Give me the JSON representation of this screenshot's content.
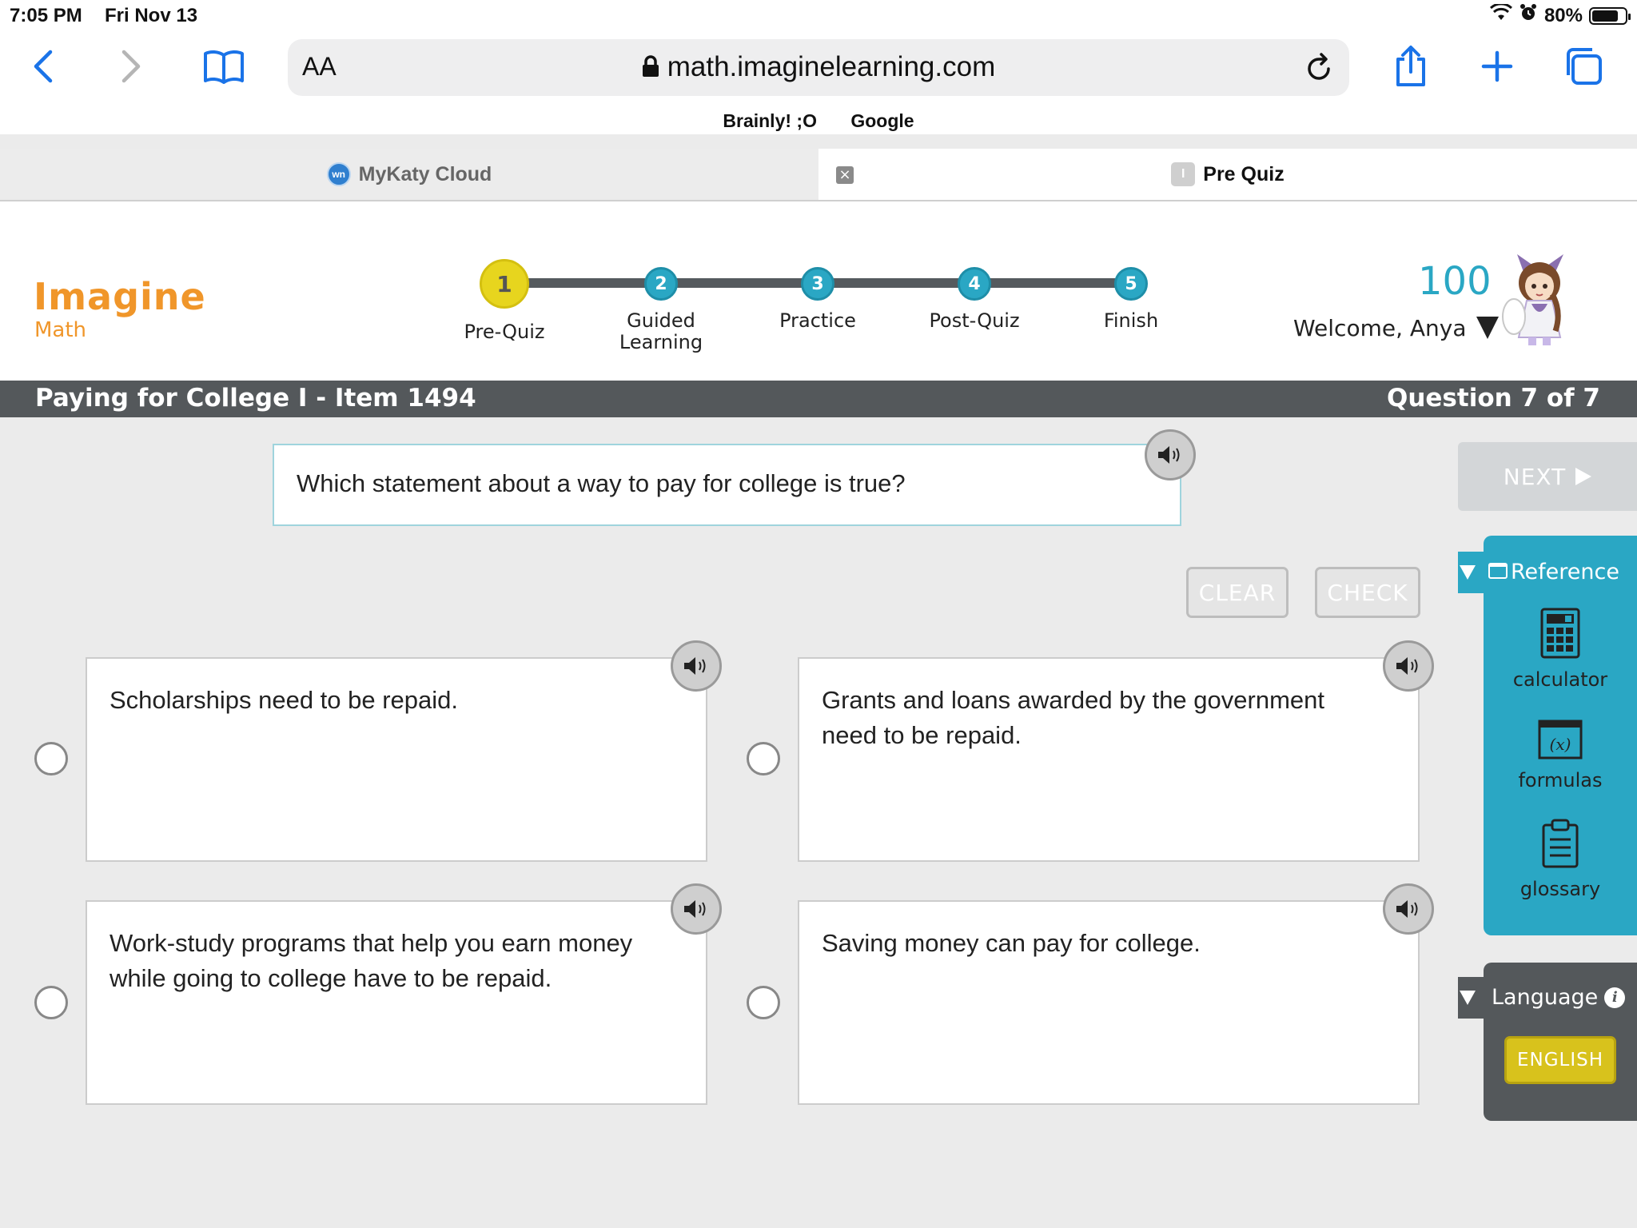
{
  "status": {
    "time": "7:05 PM",
    "date": "Fri Nov 13",
    "battery_percent": "80%",
    "battery_level": 0.8
  },
  "browser": {
    "text_size_label": "AA",
    "url": "math.imaginelearning.com",
    "bookmarks": [
      "Brainly! ;O",
      "Google"
    ],
    "tabs": [
      {
        "label": "MyKaty Cloud",
        "favicon": "wn"
      },
      {
        "label": "Pre Quiz",
        "favicon": "I"
      }
    ],
    "close_tab_glyph": "×"
  },
  "app": {
    "logo_primary": "Imagine",
    "logo_secondary": "Math",
    "steps": [
      {
        "number": "1",
        "label": "Pre-Quiz"
      },
      {
        "number": "2",
        "label": "Guided Learning"
      },
      {
        "number": "3",
        "label": "Practice"
      },
      {
        "number": "4",
        "label": "Post-Quiz"
      },
      {
        "number": "5",
        "label": "Finish"
      }
    ],
    "points": "100",
    "welcome": "Welcome, Anya"
  },
  "titlebar": {
    "lesson": "Paying for College I - Item 1494",
    "question_counter": "Question 7 of 7"
  },
  "question": {
    "prompt": "Which statement about a way to pay for college is true?",
    "clear_label": "CLEAR",
    "check_label": "CHECK",
    "options": [
      {
        "text": "Scholarships need to be repaid."
      },
      {
        "text": "Grants and loans awarded by the government need to be repaid."
      },
      {
        "text": "Work-study programs that help you earn money while going to college have to be repaid."
      },
      {
        "text": "Saving money can pay for college."
      }
    ]
  },
  "sidebar": {
    "next_label": "NEXT",
    "reference_label": "Reference",
    "reference_items": [
      {
        "label": "calculator",
        "icon": "calculator-icon"
      },
      {
        "label": "formulas",
        "icon": "formulas-icon"
      },
      {
        "label": "glossary",
        "icon": "glossary-icon"
      }
    ],
    "formulas_icon_text": "(x)",
    "language_label": "Language",
    "info_glyph": "i",
    "language_button": "ENGLISH"
  },
  "colors": {
    "accent_teal": "#2aa7c4",
    "logo_orange": "#f0962a",
    "current_step_yellow": "#e7d51e",
    "title_bar_gray": "#54585b"
  }
}
